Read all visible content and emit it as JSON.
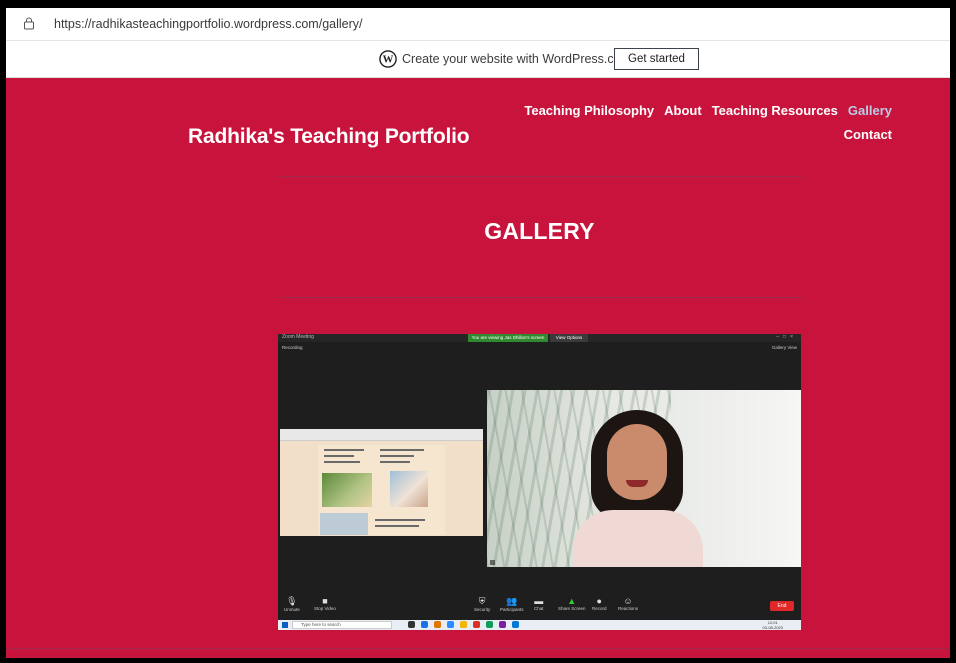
{
  "browser": {
    "url": "https://radhikasteachingportfolio.wordpress.com/gallery/"
  },
  "wp_banner": {
    "text": "Create your website with WordPress.com",
    "button": "Get started"
  },
  "site": {
    "title": "Radhika's Teaching Portfolio",
    "nav": [
      {
        "label": "Teaching Philosophy",
        "active": false
      },
      {
        "label": "About",
        "active": false
      },
      {
        "label": "Teaching Resources",
        "active": false
      },
      {
        "label": "Gallery",
        "active": true
      },
      {
        "label": "Contact",
        "active": false
      }
    ],
    "heading": "GALLERY",
    "colors": {
      "background": "#c8143c",
      "active_nav": "#b8cce8"
    }
  },
  "screenshot": {
    "window_title": "Zoom Meeting",
    "share_notice": "You are viewing Jas Dhillon's screen",
    "view_options": "View Options",
    "recording": "Recording",
    "gallery_view": "Gallery View",
    "toolbar": [
      "Unmute",
      "Stop Video",
      "Security",
      "Participants",
      "Chat",
      "Share Screen",
      "Record",
      "Reactions"
    ],
    "end": "End",
    "search_placeholder": "Type here to search",
    "clock_time": "12:01",
    "clock_date": "03-08-2023"
  }
}
